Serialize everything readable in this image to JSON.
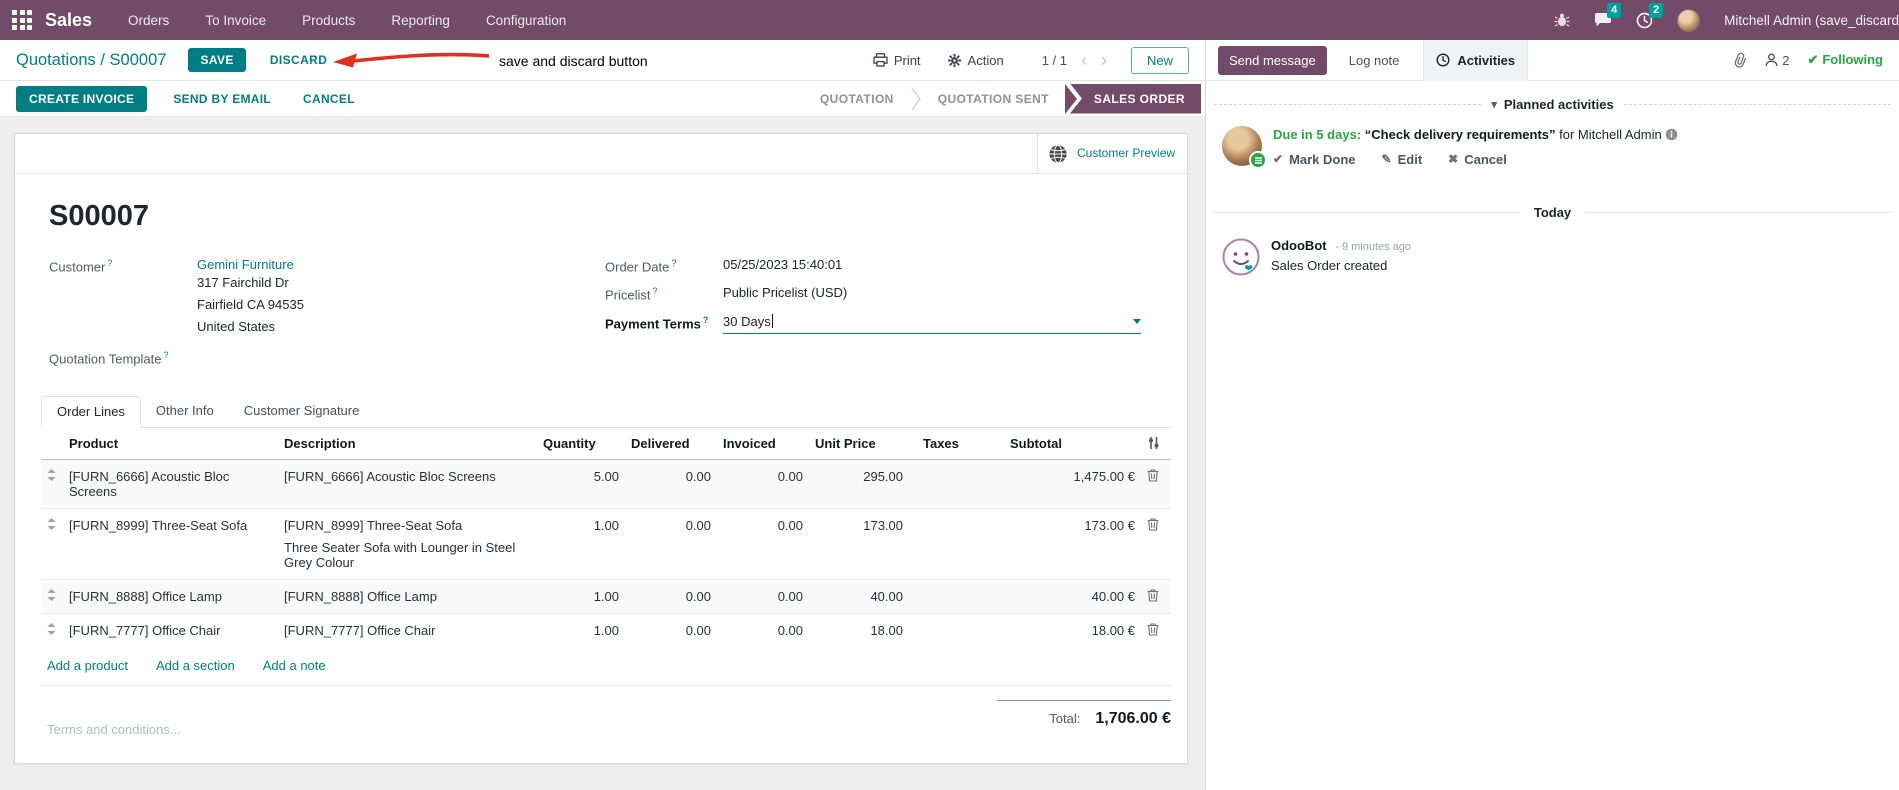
{
  "colors": {
    "navbar_purple": "#714B67",
    "accent_teal": "#017E84",
    "badge_teal": "#00A09D",
    "success_green": "#28a745",
    "annotation_red": "#E0301E",
    "active_stage_purple": "#714B67"
  },
  "icons": {
    "apps": "grid-3x3",
    "debug": "bug",
    "messages": "chat-bubble",
    "activity_clock": "clock",
    "user": "avatar-photo",
    "print": "printer",
    "action": "gear",
    "pager_prev": "chevron-left",
    "pager_next": "chevron-right",
    "customer_preview": "globe",
    "help": "question-mark",
    "dropdown": "caret-down",
    "row_drag": "up-down-arrows",
    "row_delete": "trash",
    "column_options": "sliders",
    "attachment": "paperclip",
    "followers": "person",
    "following": "checkmark",
    "mark_done": "checkmark",
    "edit": "pencil",
    "cancel": "x-mark",
    "activity_info": "info-circle",
    "odoobot": "robot-smiley",
    "activity_type": "list-lines"
  },
  "navbar": {
    "app_name": "Sales",
    "menus": [
      "Orders",
      "To Invoice",
      "Products",
      "Reporting",
      "Configuration"
    ],
    "message_badge": "4",
    "activity_badge": "2",
    "user_name": "Mitchell Admin (save_discard"
  },
  "control": {
    "breadcrumb": "Quotations / S00007",
    "save": "SAVE",
    "discard": "DISCARD",
    "annotation": "save and discard button",
    "print": "Print",
    "action": "Action",
    "pager": "1 / 1",
    "new": "New"
  },
  "statusbar": {
    "create_invoice": "CREATE INVOICE",
    "send_by_email": "SEND BY EMAIL",
    "cancel": "CANCEL",
    "stages": [
      "QUOTATION",
      "QUOTATION SENT",
      "SALES ORDER"
    ],
    "active_stage": "SALES ORDER"
  },
  "sheet": {
    "customer_preview": "Customer Preview",
    "record_name": "S00007",
    "help_marker": "?",
    "customer": {
      "label": "Customer",
      "name": "Gemini Furniture",
      "address_line1": "317 Fairchild Dr",
      "address_line2": "Fairfield CA 94535",
      "address_line3": "United States"
    },
    "quotation_template_label": "Quotation Template",
    "order_date": {
      "label": "Order Date",
      "value": "05/25/2023 15:40:01"
    },
    "pricelist": {
      "label": "Pricelist",
      "value": "Public Pricelist (USD)"
    },
    "payment_terms": {
      "label": "Payment Terms",
      "value": "30 Days"
    },
    "tabs": [
      "Order Lines",
      "Other Info",
      "Customer Signature"
    ],
    "table": {
      "headers": {
        "product": "Product",
        "description": "Description",
        "quantity": "Quantity",
        "delivered": "Delivered",
        "invoiced": "Invoiced",
        "unit_price": "Unit Price",
        "taxes": "Taxes",
        "subtotal": "Subtotal"
      },
      "rows": [
        {
          "product": "[FURN_6666] Acoustic Bloc Screens",
          "description": "[FURN_6666] Acoustic Bloc Screens",
          "quantity": "5.00",
          "delivered": "0.00",
          "invoiced": "0.00",
          "unit_price": "295.00",
          "subtotal": "1,475.00 €"
        },
        {
          "product": "[FURN_8999] Three-Seat Sofa",
          "description": "[FURN_8999] Three-Seat Sofa",
          "description_extra": "Three Seater Sofa with Lounger in Steel Grey Colour",
          "quantity": "1.00",
          "delivered": "0.00",
          "invoiced": "0.00",
          "unit_price": "173.00",
          "subtotal": "173.00 €"
        },
        {
          "product": "[FURN_8888] Office Lamp",
          "description": "[FURN_8888] Office Lamp",
          "quantity": "1.00",
          "delivered": "0.00",
          "invoiced": "0.00",
          "unit_price": "40.00",
          "subtotal": "40.00 €"
        },
        {
          "product": "[FURN_7777] Office Chair",
          "description": "[FURN_7777] Office Chair",
          "quantity": "1.00",
          "delivered": "0.00",
          "invoiced": "0.00",
          "unit_price": "18.00",
          "subtotal": "18.00 €"
        }
      ],
      "add_product": "Add a product",
      "add_section": "Add a section",
      "add_note": "Add a note"
    },
    "terms_placeholder": "Terms and conditions...",
    "total": {
      "label": "Total:",
      "value": "1,706.00 €"
    }
  },
  "chatter": {
    "send_message": "Send message",
    "log_note": "Log note",
    "activities": "Activities",
    "followers_count": "2",
    "following": "Following",
    "planned_title": "Planned activities",
    "activity": {
      "due": "Due in 5 days:",
      "summary": "“Check delivery requirements”",
      "assignee": "for Mitchell Admin",
      "mark_done": "Mark Done",
      "edit": "Edit",
      "cancel": "Cancel"
    },
    "today": "Today",
    "message": {
      "author": "OdooBot",
      "timestamp": "- 9 minutes ago",
      "body": "Sales Order created"
    }
  }
}
